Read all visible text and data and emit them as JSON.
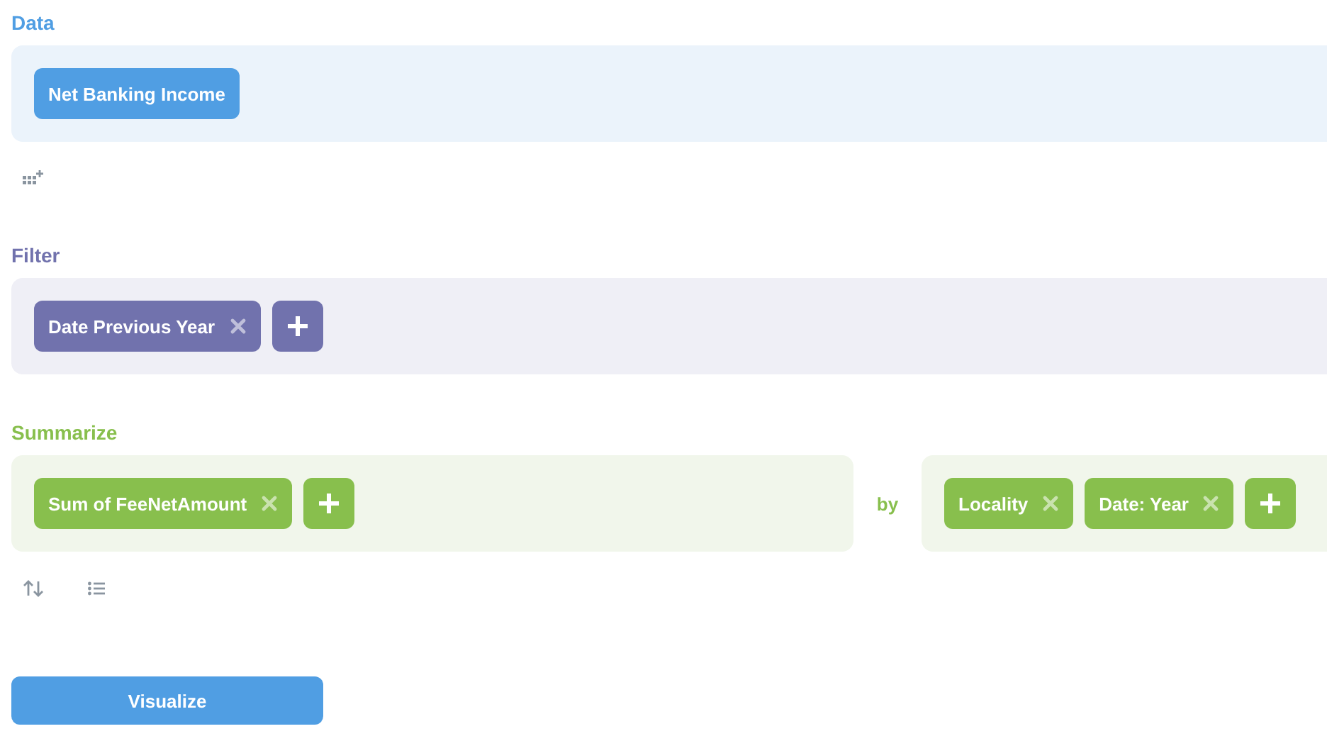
{
  "sections": [
    {
      "kind": "data",
      "label": "Data",
      "groups": [
        {
          "pills": [
            {
              "text": "Net Banking Income",
              "removable": false
            }
          ],
          "add_button": false
        }
      ]
    },
    {
      "kind": "filter",
      "label": "Filter",
      "groups": [
        {
          "pills": [
            {
              "text": "Date Previous Year",
              "removable": true
            }
          ],
          "add_button": true
        }
      ]
    },
    {
      "kind": "summarize",
      "label": "Summarize",
      "joiner": "by",
      "groups": [
        {
          "pills": [
            {
              "text": "Sum of FeeNetAmount",
              "removable": true
            }
          ],
          "add_button": true
        },
        {
          "pills": [
            {
              "text": "Locality",
              "removable": true
            },
            {
              "text": "Date: Year",
              "removable": true
            }
          ],
          "add_button": true
        }
      ]
    }
  ],
  "button": {
    "label": "Visualize"
  }
}
